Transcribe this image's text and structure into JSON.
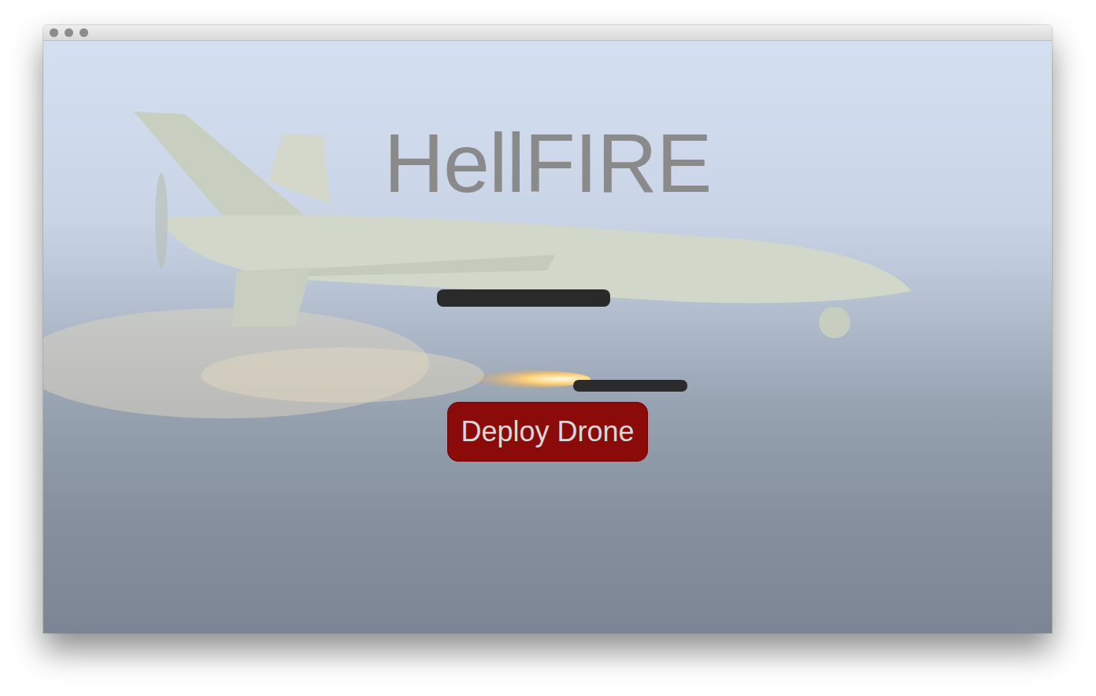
{
  "app": {
    "title": "HellFIRE"
  },
  "deploy_button": {
    "label": "Deploy Drone"
  }
}
